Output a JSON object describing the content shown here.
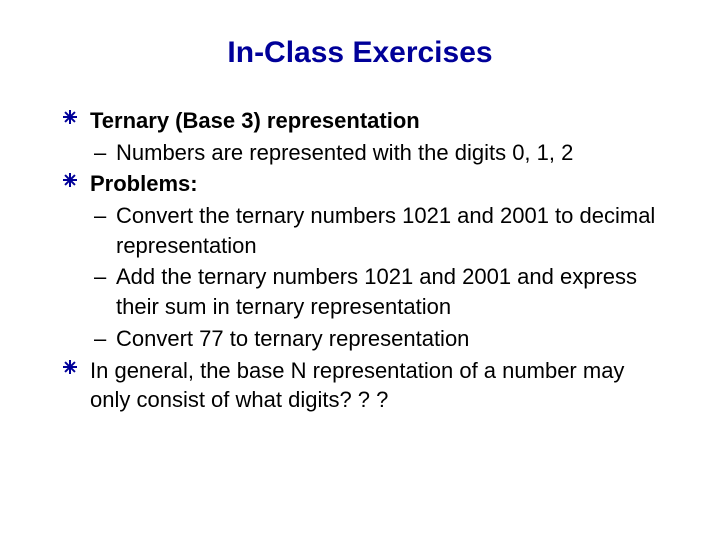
{
  "title": "In-Class Exercises",
  "items": [
    {
      "text": "Ternary (Base 3) representation",
      "sub": [
        "Numbers are represented with the digits 0, 1, 2"
      ]
    },
    {
      "text": "Problems:",
      "sub": [
        "Convert the ternary numbers 1021 and 2001 to decimal representation",
        "Add the ternary numbers 1021 and 2001 and express their sum in ternary representation",
        "Convert 77 to ternary representation"
      ]
    },
    {
      "text": "In general, the base N representation of a number may only consist of what digits? ? ?",
      "sub": []
    }
  ]
}
